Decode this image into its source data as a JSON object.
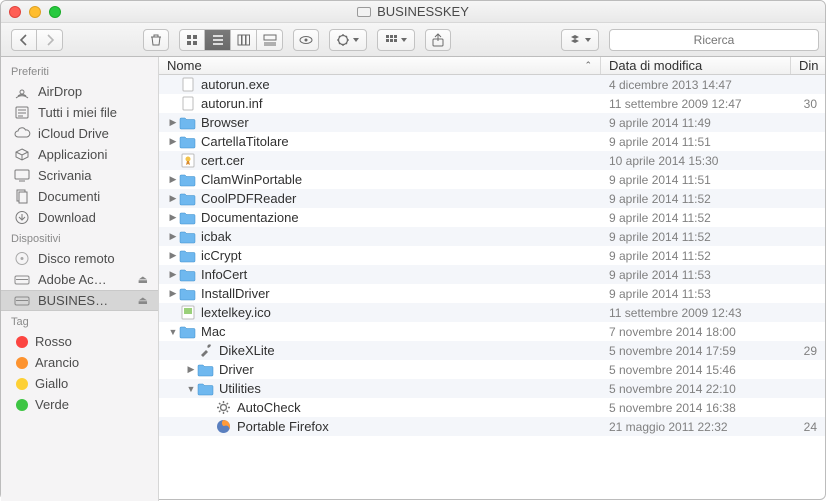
{
  "title": "BUSINESSKEY",
  "search": {
    "placeholder": "Ricerca"
  },
  "sidebar": {
    "sections": [
      {
        "title": "Preferiti",
        "items": [
          {
            "icon": "airdrop",
            "label": "AirDrop"
          },
          {
            "icon": "allfiles",
            "label": "Tutti i miei file"
          },
          {
            "icon": "icloud",
            "label": "iCloud Drive"
          },
          {
            "icon": "apps",
            "label": "Applicazioni"
          },
          {
            "icon": "desktop",
            "label": "Scrivania"
          },
          {
            "icon": "docs",
            "label": "Documenti"
          },
          {
            "icon": "download",
            "label": "Download"
          }
        ]
      },
      {
        "title": "Dispositivi",
        "items": [
          {
            "icon": "remotedisk",
            "label": "Disco remoto"
          },
          {
            "icon": "disk",
            "label": "Adobe Ac…",
            "eject": true
          },
          {
            "icon": "disk",
            "label": "BUSINES…",
            "eject": true,
            "selected": true
          }
        ]
      },
      {
        "title": "Tag",
        "items": [
          {
            "color": "#fc4541",
            "label": "Rosso"
          },
          {
            "color": "#fd932f",
            "label": "Arancio"
          },
          {
            "color": "#fdd035",
            "label": "Giallo"
          },
          {
            "color": "#3ec544",
            "label": "Verde"
          }
        ]
      }
    ]
  },
  "columns": {
    "name": "Nome",
    "date": "Data di modifica",
    "size": "Din"
  },
  "rows": [
    {
      "depth": 0,
      "kind": "file",
      "icon": "exe",
      "name": "autorun.exe",
      "date": "4 dicembre 2013 14:47",
      "size": ""
    },
    {
      "depth": 0,
      "kind": "file",
      "icon": "blank",
      "name": "autorun.inf",
      "date": "11 settembre 2009 12:47",
      "size": "30"
    },
    {
      "depth": 0,
      "kind": "folder",
      "expanded": false,
      "name": "Browser",
      "date": "9 aprile 2014 11:49",
      "size": ""
    },
    {
      "depth": 0,
      "kind": "folder",
      "expanded": false,
      "name": "CartellaTitolare",
      "date": "9 aprile 2014 11:51",
      "size": ""
    },
    {
      "depth": 0,
      "kind": "file",
      "icon": "cert",
      "name": "cert.cer",
      "date": "10 aprile 2014 15:30",
      "size": ""
    },
    {
      "depth": 0,
      "kind": "folder",
      "expanded": false,
      "name": "ClamWinPortable",
      "date": "9 aprile 2014 11:51",
      "size": ""
    },
    {
      "depth": 0,
      "kind": "folder",
      "expanded": false,
      "name": "CoolPDFReader",
      "date": "9 aprile 2014 11:52",
      "size": ""
    },
    {
      "depth": 0,
      "kind": "folder",
      "expanded": false,
      "name": "Documentazione",
      "date": "9 aprile 2014 11:52",
      "size": ""
    },
    {
      "depth": 0,
      "kind": "folder",
      "expanded": false,
      "name": "icbak",
      "date": "9 aprile 2014 11:52",
      "size": ""
    },
    {
      "depth": 0,
      "kind": "folder",
      "expanded": false,
      "name": "icCrypt",
      "date": "9 aprile 2014 11:52",
      "size": ""
    },
    {
      "depth": 0,
      "kind": "folder",
      "expanded": false,
      "name": "InfoCert",
      "date": "9 aprile 2014 11:53",
      "size": ""
    },
    {
      "depth": 0,
      "kind": "folder",
      "expanded": false,
      "name": "InstallDriver",
      "date": "9 aprile 2014 11:53",
      "size": ""
    },
    {
      "depth": 0,
      "kind": "file",
      "icon": "ico",
      "name": "lextelkey.ico",
      "date": "11 settembre 2009 12:43",
      "size": ""
    },
    {
      "depth": 0,
      "kind": "folder",
      "expanded": true,
      "name": "Mac",
      "date": "7 novembre 2014 18:00",
      "size": ""
    },
    {
      "depth": 1,
      "kind": "file",
      "icon": "tool",
      "name": "DikeXLite",
      "date": "5 novembre 2014 17:59",
      "size": "29"
    },
    {
      "depth": 1,
      "kind": "folder",
      "expanded": false,
      "name": "Driver",
      "date": "5 novembre 2014 15:46",
      "size": ""
    },
    {
      "depth": 1,
      "kind": "folder",
      "expanded": true,
      "name": "Utilities",
      "date": "5 novembre 2014 22:10",
      "size": ""
    },
    {
      "depth": 2,
      "kind": "file",
      "icon": "gear",
      "name": "AutoCheck",
      "date": "5 novembre 2014 16:38",
      "size": ""
    },
    {
      "depth": 2,
      "kind": "file",
      "icon": "firefox",
      "name": "Portable Firefox",
      "date": "21 maggio 2011 22:32",
      "size": "24"
    }
  ]
}
